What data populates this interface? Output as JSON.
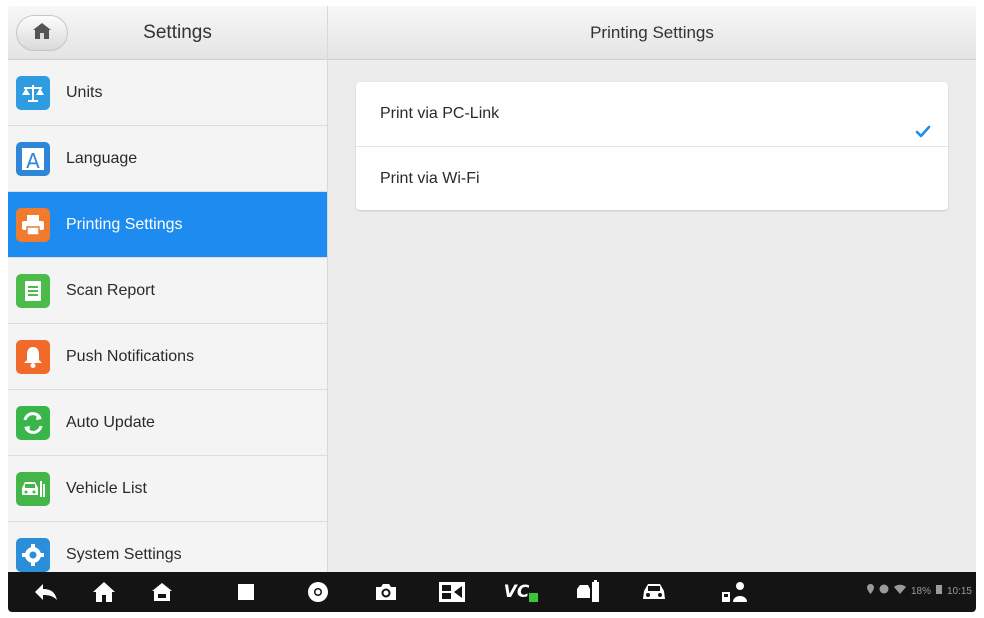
{
  "header": {
    "left_title": "Settings",
    "right_title": "Printing Settings",
    "home_icon": "home-icon"
  },
  "sidebar": {
    "items": [
      {
        "label": "Units",
        "icon": "scale-icon",
        "color": "#2f9be0",
        "active": false
      },
      {
        "label": "Language",
        "icon": "language-icon",
        "color": "#2f86d6",
        "active": false
      },
      {
        "label": "Printing Settings",
        "icon": "printer-icon",
        "color": "#f07a2e",
        "active": true
      },
      {
        "label": "Scan Report",
        "icon": "report-icon",
        "color": "#4cbb4a",
        "active": false
      },
      {
        "label": "Push Notifications",
        "icon": "bell-icon",
        "color": "#f06a2a",
        "active": false
      },
      {
        "label": "Auto Update",
        "icon": "refresh-icon",
        "color": "#39b54a",
        "active": false
      },
      {
        "label": "Vehicle List",
        "icon": "vehicle-list-icon",
        "color": "#44b649",
        "active": false
      },
      {
        "label": "System Settings",
        "icon": "gear-icon",
        "color": "#2a8ed8",
        "active": false
      }
    ],
    "active_color": "#1e8bf0"
  },
  "printing_options": [
    {
      "label": "Print via PC-Link",
      "selected": true
    },
    {
      "label": "Print via Wi-Fi",
      "selected": false
    }
  ],
  "taskbar": {
    "icons": [
      "back-icon",
      "home-icon",
      "house-icon",
      "recent-apps-icon",
      "chrome-icon",
      "camera-icon",
      "screen-icon",
      "vci-icon",
      "battery-voltage-icon",
      "car-icon",
      "remote-expert-icon"
    ],
    "vci_label": "VC",
    "status_text": "18%",
    "time": "10:15"
  }
}
